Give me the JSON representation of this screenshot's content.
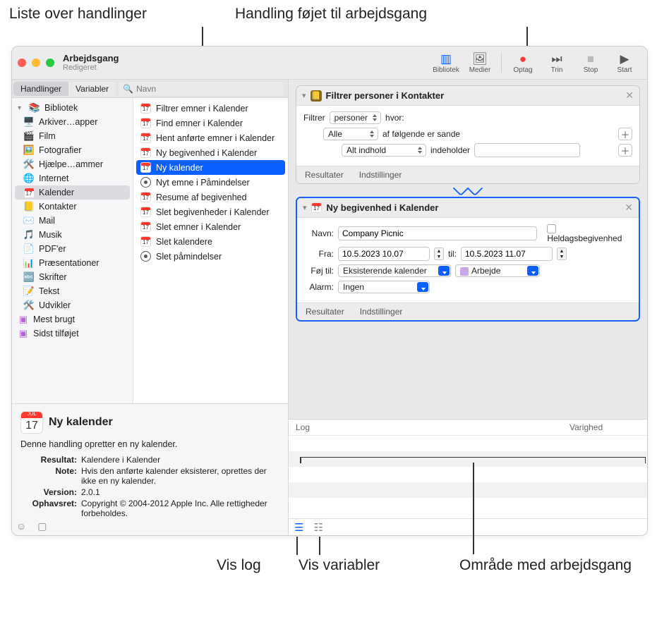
{
  "callouts": {
    "top_left": "Liste over handlinger",
    "top_right": "Handling føjet til arbejdsgang",
    "bottom_log": "Vis log",
    "bottom_vars": "Vis variabler",
    "bottom_area": "Område med arbejdsgang"
  },
  "titlebar": {
    "title": "Arbejdsgang",
    "subtitle": "Redigeret",
    "buttons": {
      "library": "Bibliotek",
      "media": "Medier",
      "record": "Optag",
      "step": "Trin",
      "stop": "Stop",
      "run": "Start"
    }
  },
  "tabs": {
    "actions": "Handlinger",
    "variables": "Variabler",
    "search_placeholder": "Navn"
  },
  "library": {
    "root": "Bibliotek",
    "items": [
      {
        "label": "Arkiver…apper",
        "icon": "🖥️"
      },
      {
        "label": "Film",
        "icon": "🎬"
      },
      {
        "label": "Fotografier",
        "icon": "🖼️"
      },
      {
        "label": "Hjælpe…ammer",
        "icon": "🛠️"
      },
      {
        "label": "Internet",
        "icon": "🌐"
      },
      {
        "label": "Kalender",
        "icon": "cal",
        "selected": true
      },
      {
        "label": "Kontakter",
        "icon": "📒"
      },
      {
        "label": "Mail",
        "icon": "✉️"
      },
      {
        "label": "Musik",
        "icon": "🎵"
      },
      {
        "label": "PDF'er",
        "icon": "📄"
      },
      {
        "label": "Præsentationer",
        "icon": "📊"
      },
      {
        "label": "Skrifter",
        "icon": "🔤"
      },
      {
        "label": "Tekst",
        "icon": "📝"
      },
      {
        "label": "Udvikler",
        "icon": "🛠️"
      }
    ],
    "smart": [
      {
        "label": "Mest brugt"
      },
      {
        "label": "Sidst tilføjet"
      }
    ]
  },
  "actions": [
    {
      "label": "Filtrer emner i Kalender",
      "icon": "cal"
    },
    {
      "label": "Find emner i Kalender",
      "icon": "cal"
    },
    {
      "label": "Hent anførte emner i Kalender",
      "icon": "cal"
    },
    {
      "label": "Ny begivenhed i Kalender",
      "icon": "cal"
    },
    {
      "label": "Ny kalender",
      "icon": "cal",
      "selected": true
    },
    {
      "label": "Nyt emne i Påmindelser",
      "icon": "rem"
    },
    {
      "label": "Resume af begivenhed",
      "icon": "cal"
    },
    {
      "label": "Slet begivenheder i Kalender",
      "icon": "cal"
    },
    {
      "label": "Slet emner i Kalender",
      "icon": "cal"
    },
    {
      "label": "Slet kalendere",
      "icon": "cal"
    },
    {
      "label": "Slet påmindelser",
      "icon": "rem"
    }
  ],
  "info": {
    "title": "Ny kalender",
    "desc": "Denne handling opretter en ny kalender.",
    "rows": {
      "resultat_lbl": "Resultat:",
      "resultat": "Kalendere i Kalender",
      "note_lbl": "Note:",
      "note": "Hvis den anførte kalender eksisterer, oprettes der ikke en ny kalender.",
      "version_lbl": "Version:",
      "version": "2.0.1",
      "copyright_lbl": "Ophavsret:",
      "copyright": "Copyright © 2004-2012 Apple Inc. Alle rettigheder forbeholdes."
    }
  },
  "wf": {
    "card1": {
      "title": "Filtrer personer i Kontakter",
      "filter_lbl": "Filtrer",
      "filter_sel": "personer",
      "where": "hvor:",
      "all": "Alle",
      "following": "af følgende er sande",
      "allcontent": "Alt indhold",
      "contains": "indeholder",
      "results": "Resultater",
      "settings": "Indstillinger"
    },
    "card2": {
      "title": "Ny begivenhed i Kalender",
      "name_lbl": "Navn:",
      "name_val": "Company Picnic",
      "allday": "Heldagsbegivenhed",
      "from_lbl": "Fra:",
      "from_val": "10.5.2023 10.07",
      "to_lbl": "til:",
      "to_val": "10.5.2023 11.07",
      "addto_lbl": "Føj til:",
      "addto_sel": "Eksisterende kalender",
      "cal_sel": "Arbejde",
      "alarm_lbl": "Alarm:",
      "alarm_sel": "Ingen",
      "results": "Resultater",
      "settings": "Indstillinger"
    }
  },
  "log": {
    "header_log": "Log",
    "header_dur": "Varighed"
  }
}
